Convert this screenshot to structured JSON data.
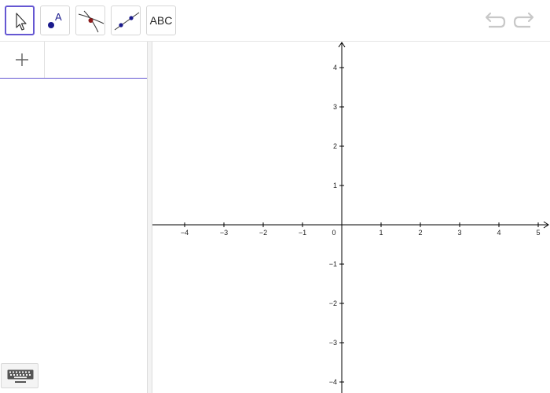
{
  "toolbar": {
    "tools": [
      {
        "id": "move",
        "icon": "move-arrow-icon"
      },
      {
        "id": "point",
        "icon": "point-icon",
        "label": "A"
      },
      {
        "id": "intersect",
        "icon": "intersect-icon"
      },
      {
        "id": "line",
        "icon": "line-through-two-points-icon"
      },
      {
        "id": "text",
        "icon": "text-icon",
        "label": "ABC"
      }
    ],
    "undo_icon": "undo-icon",
    "redo_icon": "redo-icon"
  },
  "algebra": {
    "add_icon": "plus-icon",
    "input_value": "",
    "input_placeholder": ""
  },
  "keyboard": {
    "icon": "keyboard-icon"
  },
  "graph": {
    "x_ticks": [
      "−4",
      "−3",
      "−2",
      "−1",
      "1",
      "2",
      "3",
      "4",
      "5"
    ],
    "y_ticks": [
      "4",
      "3",
      "2",
      "1",
      "−1",
      "−2",
      "−3",
      "−4"
    ],
    "origin_label": "0",
    "axis_color": "#000000"
  },
  "colors": {
    "accent": "#6557d2",
    "point": "#1a1a8c",
    "intersection_point": "#8b1a1a"
  }
}
